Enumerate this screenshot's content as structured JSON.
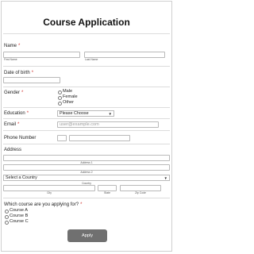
{
  "form": {
    "title": "Course Application",
    "required_mark": "*",
    "name": {
      "label": "Name",
      "first_sub": "First Name",
      "last_sub": "Last Name",
      "first_value": "",
      "last_value": ""
    },
    "dob": {
      "label": "Date of birth",
      "value": ""
    },
    "gender": {
      "label": "Gender",
      "options": [
        "Male",
        "Female",
        "Other"
      ]
    },
    "education": {
      "label": "Education",
      "selected": "Please Choose"
    },
    "email": {
      "label": "Email",
      "placeholder": "user@example.com"
    },
    "phone": {
      "label": "Phone Number"
    },
    "address": {
      "label": "Address",
      "line1_sub": "Address 1",
      "line2_sub": "Address 2",
      "country_selected": "Select a Country",
      "country_sub": "Country",
      "city_sub": "City",
      "state_sub": "State",
      "zip_sub": "Zip Code"
    },
    "course": {
      "label": "Which course are you applying for?",
      "options": [
        "Course A",
        "Course B",
        "Course C"
      ]
    },
    "apply_label": "Apply"
  },
  "colors": {
    "required": "#d0312d",
    "button": "#707070",
    "border": "#b9b9b9"
  }
}
